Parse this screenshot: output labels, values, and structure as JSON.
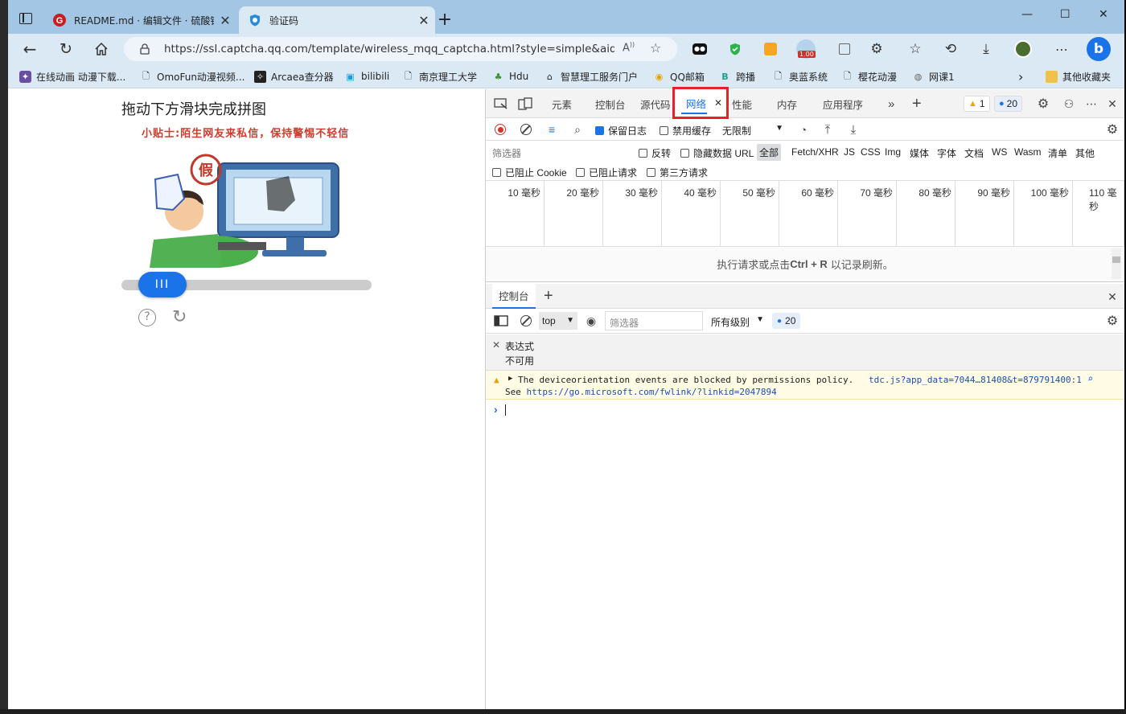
{
  "browser": {
    "tabs": [
      {
        "title": "README.md · 编辑文件 · 硫酸钡",
        "close": "✕"
      },
      {
        "title": "验证码",
        "close": "✕"
      }
    ],
    "new_tab": "+",
    "window_controls": [
      "—",
      "☐",
      "✕"
    ],
    "url": "https://ssl.captcha.qq.com/template/wireless_mqq_captcha.html?style=simple&aid=...",
    "zoom_badge": "1.00",
    "bookmarks": [
      "在线动画 动漫下载...",
      "OmoFun动漫视频...",
      "Arcaea查分器",
      "bilibili",
      "南京理工大学",
      "Hdu",
      "智慧理工服务门户",
      "QQ邮箱",
      "跨播",
      "奥蓝系统",
      "樱花动漫",
      "网课1"
    ],
    "other_bookmarks": "其他收藏夹"
  },
  "captcha": {
    "title": "拖动下方滑块完成拼图",
    "tip": "小贴士:陌生网友来私信，保持警惕不轻信",
    "stamp": "假",
    "handle": "III",
    "help": "?",
    "refresh": "↻"
  },
  "devtools": {
    "tabs": [
      "元素",
      "控制台",
      "源代码",
      "网络",
      "性能",
      "内存",
      "应用程序"
    ],
    "active_tab": "网络",
    "active_close": "✕",
    "warn_count": "1",
    "msg_count": "20",
    "net": {
      "preserve_log": "保留日志",
      "disable_cache": "禁用缓存",
      "throttle": "无限制",
      "filter_placeholder": "筛选器",
      "invert": "反转",
      "hide_data_url": "隐藏数据 URL",
      "types": [
        "全部",
        "Fetch/XHR",
        "JS",
        "CSS",
        "Img",
        "媒体",
        "字体",
        "文档",
        "WS",
        "Wasm",
        "清单",
        "其他"
      ],
      "blocked_cookies": "已阻止 Cookie",
      "blocked_requests": "已阻止请求",
      "third_party": "第三方请求",
      "ticks": [
        "10 毫秒",
        "20 毫秒",
        "30 毫秒",
        "40 毫秒",
        "50 毫秒",
        "60 毫秒",
        "70 毫秒",
        "80 毫秒",
        "90 毫秒",
        "100 毫秒",
        "110 毫秒"
      ],
      "hint_pre": "执行请求或点击",
      "hint_key": "Ctrl + R",
      "hint_post": "以记录刷新。"
    },
    "drawer": {
      "tab": "控制台",
      "context": "top",
      "filter_placeholder": "筛选器",
      "levels": "所有级别",
      "msg_count": "20",
      "expression_label": "表达式",
      "expression_value": "不可用",
      "warning_line1": "The deviceorientation events are blocked by permissions policy.",
      "warning_see": "See",
      "warning_link": "https://go.microsoft.com/fwlink/?linkid=2047894",
      "warning_source": "tdc.js?app_data=7044…81408&t=879791400:1",
      "prompt": "›"
    }
  }
}
